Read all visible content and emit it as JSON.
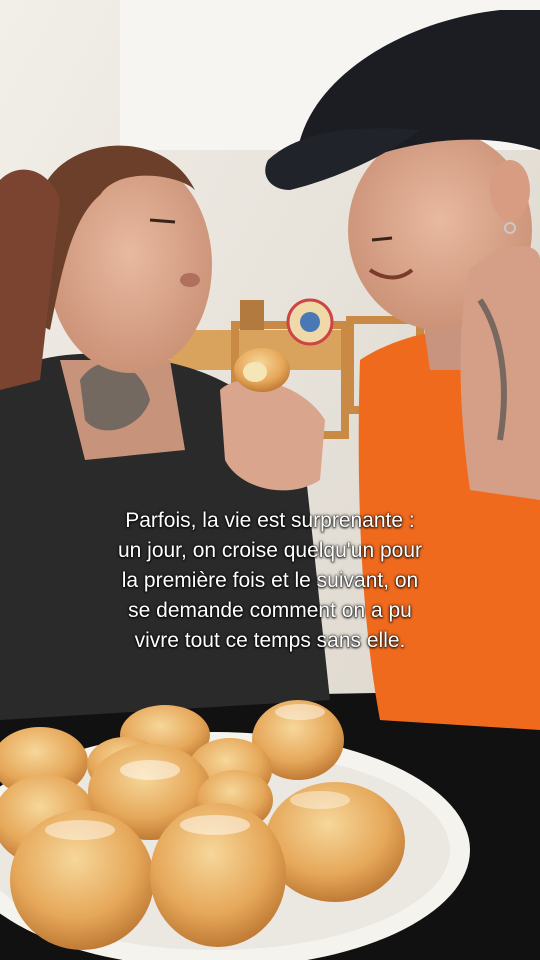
{
  "caption": {
    "lines": [
      "Parfois, la vie est surprenante :",
      "un jour, on croise quelqu'un pour",
      "la première fois et le suivant, on",
      "se demande comment on a pu",
      "vivre tout ce temps sans elle."
    ]
  }
}
